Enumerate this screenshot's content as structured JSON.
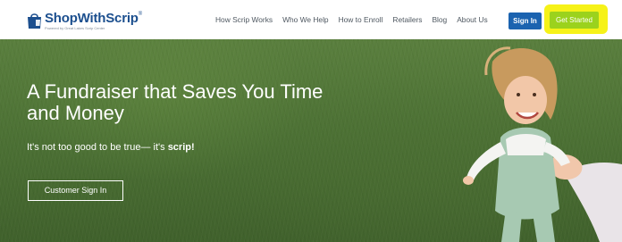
{
  "header": {
    "logo": {
      "name": "ShopWithScrip",
      "trademark": "®",
      "tagline": "Powered by Great Lakes Scrip Center"
    },
    "nav": [
      {
        "label": "How Scrip Works"
      },
      {
        "label": "Who We Help"
      },
      {
        "label": "How to Enroll"
      },
      {
        "label": "Retailers"
      },
      {
        "label": "Blog"
      },
      {
        "label": "About Us"
      }
    ],
    "sign_in_label": "Sign In",
    "get_started_label": "Get Started"
  },
  "hero": {
    "headline": "A Fundraiser that Saves You Time and Money",
    "subline_prefix": "It's not too good to be true— it's ",
    "subline_emphasis": "scrip!",
    "cta_label": "Customer Sign In"
  },
  "colors": {
    "brand_blue": "#1c4f8e",
    "sign_in_bg": "#1b63b0",
    "get_started_bg": "#9bd21d",
    "highlight": "#f6f218",
    "hero_green": "#4d7235"
  }
}
